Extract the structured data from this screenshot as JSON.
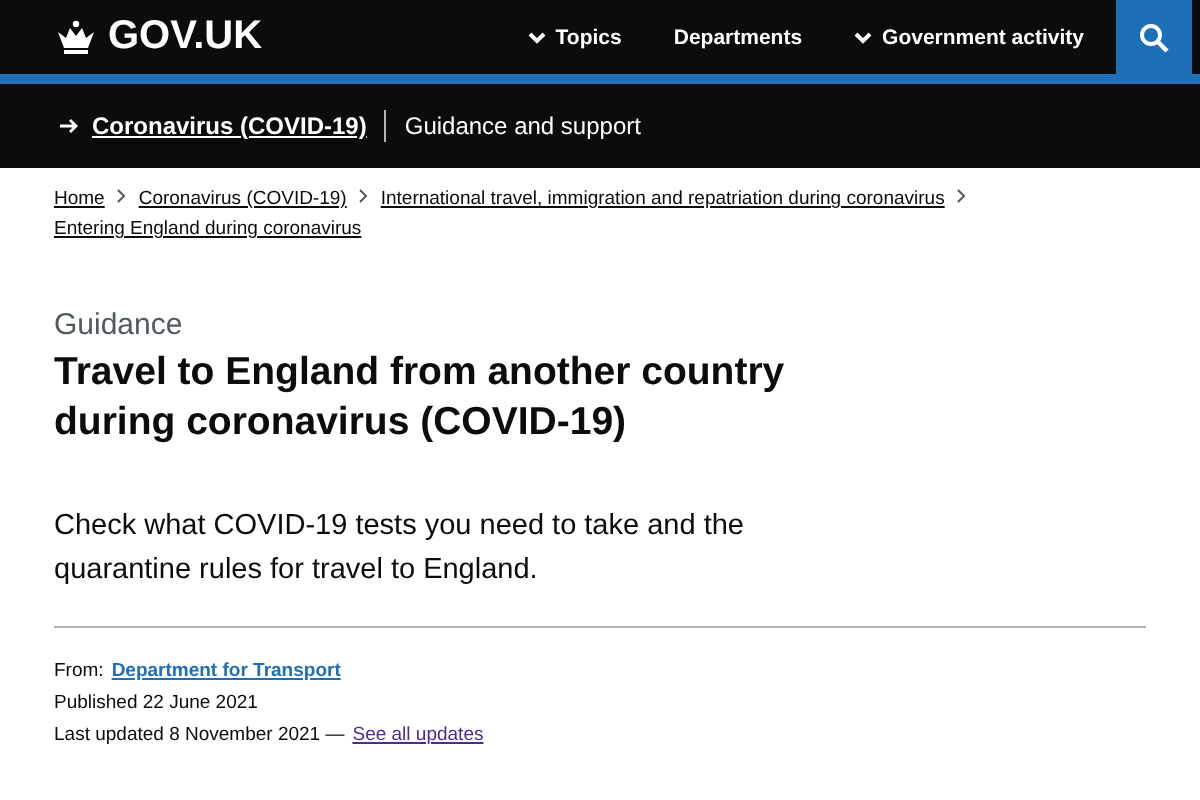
{
  "header": {
    "logo": "GOV.UK",
    "nav": [
      {
        "label": "Topics",
        "has_menu": true
      },
      {
        "label": "Departments",
        "has_menu": false
      },
      {
        "label": "Government activity",
        "has_menu": true
      }
    ]
  },
  "topic_bar": {
    "link": "Coronavirus (COVID-19)",
    "text": "Guidance and support"
  },
  "breadcrumbs": [
    "Home",
    "Coronavirus (COVID-19)",
    "International travel, immigration and repatriation during coronavirus",
    "Entering England during coronavirus"
  ],
  "caption": "Guidance",
  "title": "Travel to England from another country during coronavirus (COVID-19)",
  "summary": "Check what COVID-19 tests you need to take and the quarantine rules for travel to England.",
  "meta": {
    "from_label": "From:",
    "from_link": {
      "text": "Department for Transport",
      "visited": false
    },
    "published": "Published 22 June 2021",
    "last_updated": "Last updated 8 November 2021 —",
    "updates_link": {
      "text": "See all updates",
      "visited": true
    }
  }
}
